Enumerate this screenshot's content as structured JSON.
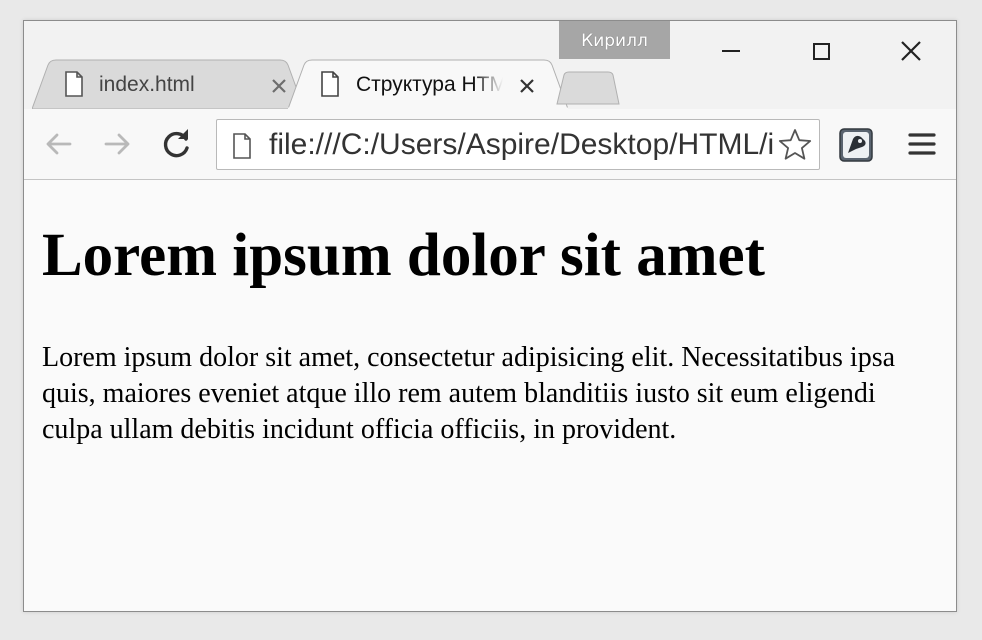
{
  "window": {
    "profile_name": "Кирилл"
  },
  "tabs": [
    {
      "title": "index.html",
      "active": false
    },
    {
      "title": "Структура HTML",
      "active": true
    }
  ],
  "toolbar": {
    "url": "file:///C:/Users/Aspire/Desktop/HTML/index.html"
  },
  "page": {
    "heading": "Lorem ipsum dolor sit amet",
    "paragraph": "Lorem ipsum dolor sit amet, consectetur adipisicing elit. Necessitatibus ipsa quis, maiores eveniet atque illo rem autem blanditiis iusto sit eum eligendi culpa ullam debitis incidunt officia officiis, in provident."
  },
  "icons": {
    "back": "arrow-left-icon",
    "forward": "arrow-right-icon",
    "reload": "reload-icon",
    "page": "document-icon",
    "bookmark": "star-icon",
    "extension": "extension-icon",
    "menu": "hamburger-menu-icon",
    "minimize": "minimize-icon",
    "maximize": "maximize-icon",
    "close": "close-icon"
  }
}
